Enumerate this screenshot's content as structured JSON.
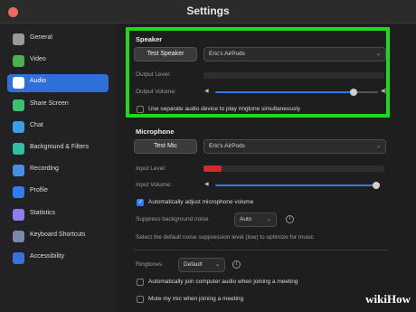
{
  "window": {
    "title": "Settings"
  },
  "sidebar": {
    "items": [
      {
        "label": "General",
        "icon": "gear-icon",
        "color": "#9a9a9a",
        "active": false
      },
      {
        "label": "Video",
        "icon": "video-icon",
        "color": "#4caf50",
        "active": false
      },
      {
        "label": "Audio",
        "icon": "headphones-icon",
        "color": "#2f6fd8",
        "active": true
      },
      {
        "label": "Share Screen",
        "icon": "share-screen-icon",
        "color": "#3cbf71",
        "active": false
      },
      {
        "label": "Chat",
        "icon": "chat-icon",
        "color": "#39a0e8",
        "active": false
      },
      {
        "label": "Background & Filters",
        "icon": "background-icon",
        "color": "#2ebfa5",
        "active": false
      },
      {
        "label": "Recording",
        "icon": "recording-icon",
        "color": "#4a90e2",
        "active": false
      },
      {
        "label": "Profile",
        "icon": "profile-icon",
        "color": "#2f7bf0",
        "active": false
      },
      {
        "label": "Statistics",
        "icon": "statistics-icon",
        "color": "#8e7cf0",
        "active": false
      },
      {
        "label": "Keyboard Shortcuts",
        "icon": "keyboard-icon",
        "color": "#7a8aa8",
        "active": false
      },
      {
        "label": "Accessibility",
        "icon": "accessibility-icon",
        "color": "#3a6fe0",
        "active": false
      }
    ]
  },
  "speaker": {
    "title": "Speaker",
    "test_button": "Test Speaker",
    "device": "Eric's AirPods",
    "output_level_label": "Output Level:",
    "output_volume_label": "Output Volume:",
    "output_volume_level": 0.85,
    "separate_device_label": "Use separate audio device to play ringtone simultaneously",
    "separate_device_checked": false
  },
  "microphone": {
    "title": "Microphone",
    "test_button": "Test Mic",
    "device": "Eric's AirPods",
    "input_level_label": "Input Level:",
    "input_level": 0.1,
    "input_volume_label": "Input Volume:",
    "input_volume_level": 0.99,
    "auto_adjust_label": "Automatically adjust microphone volume",
    "auto_adjust_checked": true
  },
  "noise": {
    "label": "Suppress background noise",
    "value": "Auto",
    "hint": "Select the default noise suppression level (low) to optimize for music"
  },
  "ringtones": {
    "label": "Ringtones",
    "value": "Default"
  },
  "options": {
    "auto_join_label": "Automatically join computer audio when joining a meeting",
    "mute_label": "Mute my mic when joining a meeting"
  },
  "watermark": {
    "prefix": "wiki",
    "suffix": "How"
  },
  "colors": {
    "highlight": "#22d81d",
    "accent": "#2f7bf0",
    "meter_red": "#d7282b"
  }
}
